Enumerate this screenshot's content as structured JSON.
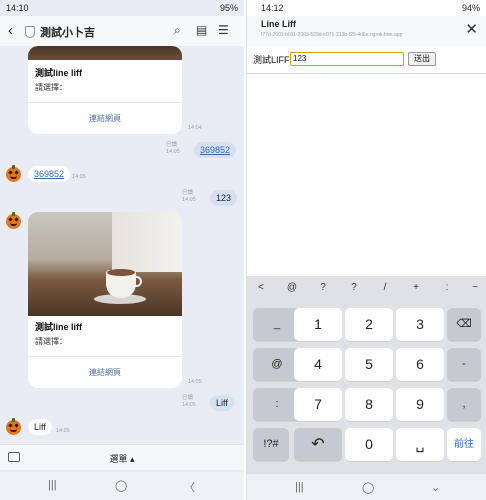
{
  "left": {
    "status": {
      "time": "14:10",
      "battery": "95%"
    },
    "header": {
      "back": "‹",
      "title": "測試小卜吉"
    },
    "cards": [
      {
        "title": "測試line liff",
        "subtitle": "請選擇：",
        "link": "連結網頁",
        "time": "14:04"
      },
      {
        "title": "測試line liff",
        "subtitle": "請選擇：",
        "link": "連結網頁",
        "time": "14:05"
      }
    ],
    "messages": [
      {
        "side": "right",
        "text": "369852",
        "read": "已讀",
        "time": "14:05"
      },
      {
        "side": "left",
        "text": "369852",
        "time": "14:05"
      },
      {
        "side": "right",
        "text": "123",
        "read": "已讀",
        "time": "14:05"
      },
      {
        "side": "right",
        "text": "Liff",
        "read": "已讀",
        "time": "14:05"
      },
      {
        "side": "left",
        "text": "Liff",
        "time": "14:05"
      }
    ],
    "bottom": {
      "menu": "選單 ▴"
    },
    "nav": {
      "recent": "|||",
      "home": "◯",
      "back": "〈"
    }
  },
  "right": {
    "status": {
      "time": "14:12",
      "battery": "94%"
    },
    "liff": {
      "title": "Line Liff",
      "url": "f77d-2001-b011-2003-529d-e071-213b-f29-4d6e.ngrok-free.app",
      "label": "測試LIFF",
      "value": "123",
      "button": "送出"
    },
    "keyboard": {
      "top": [
        "<",
        "@",
        "?",
        "?",
        "/",
        "+",
        ":",
        "~"
      ],
      "rows": [
        [
          "_",
          "1",
          "2",
          "3",
          "⌫"
        ],
        [
          "@",
          "4",
          "5",
          "6",
          "-"
        ],
        [
          ":",
          "7",
          "8",
          "9",
          ","
        ],
        [
          "!?#",
          "↶",
          "0",
          "␣",
          "前往"
        ]
      ]
    },
    "nav": {
      "recent": "|||",
      "home": "◯",
      "back": "⌄"
    }
  },
  "colors": {
    "chat_bg": "#e9ecf3",
    "bubble_sent": "#d5e0f2",
    "link": "#3a66b0",
    "go": "#2f6fdc"
  }
}
